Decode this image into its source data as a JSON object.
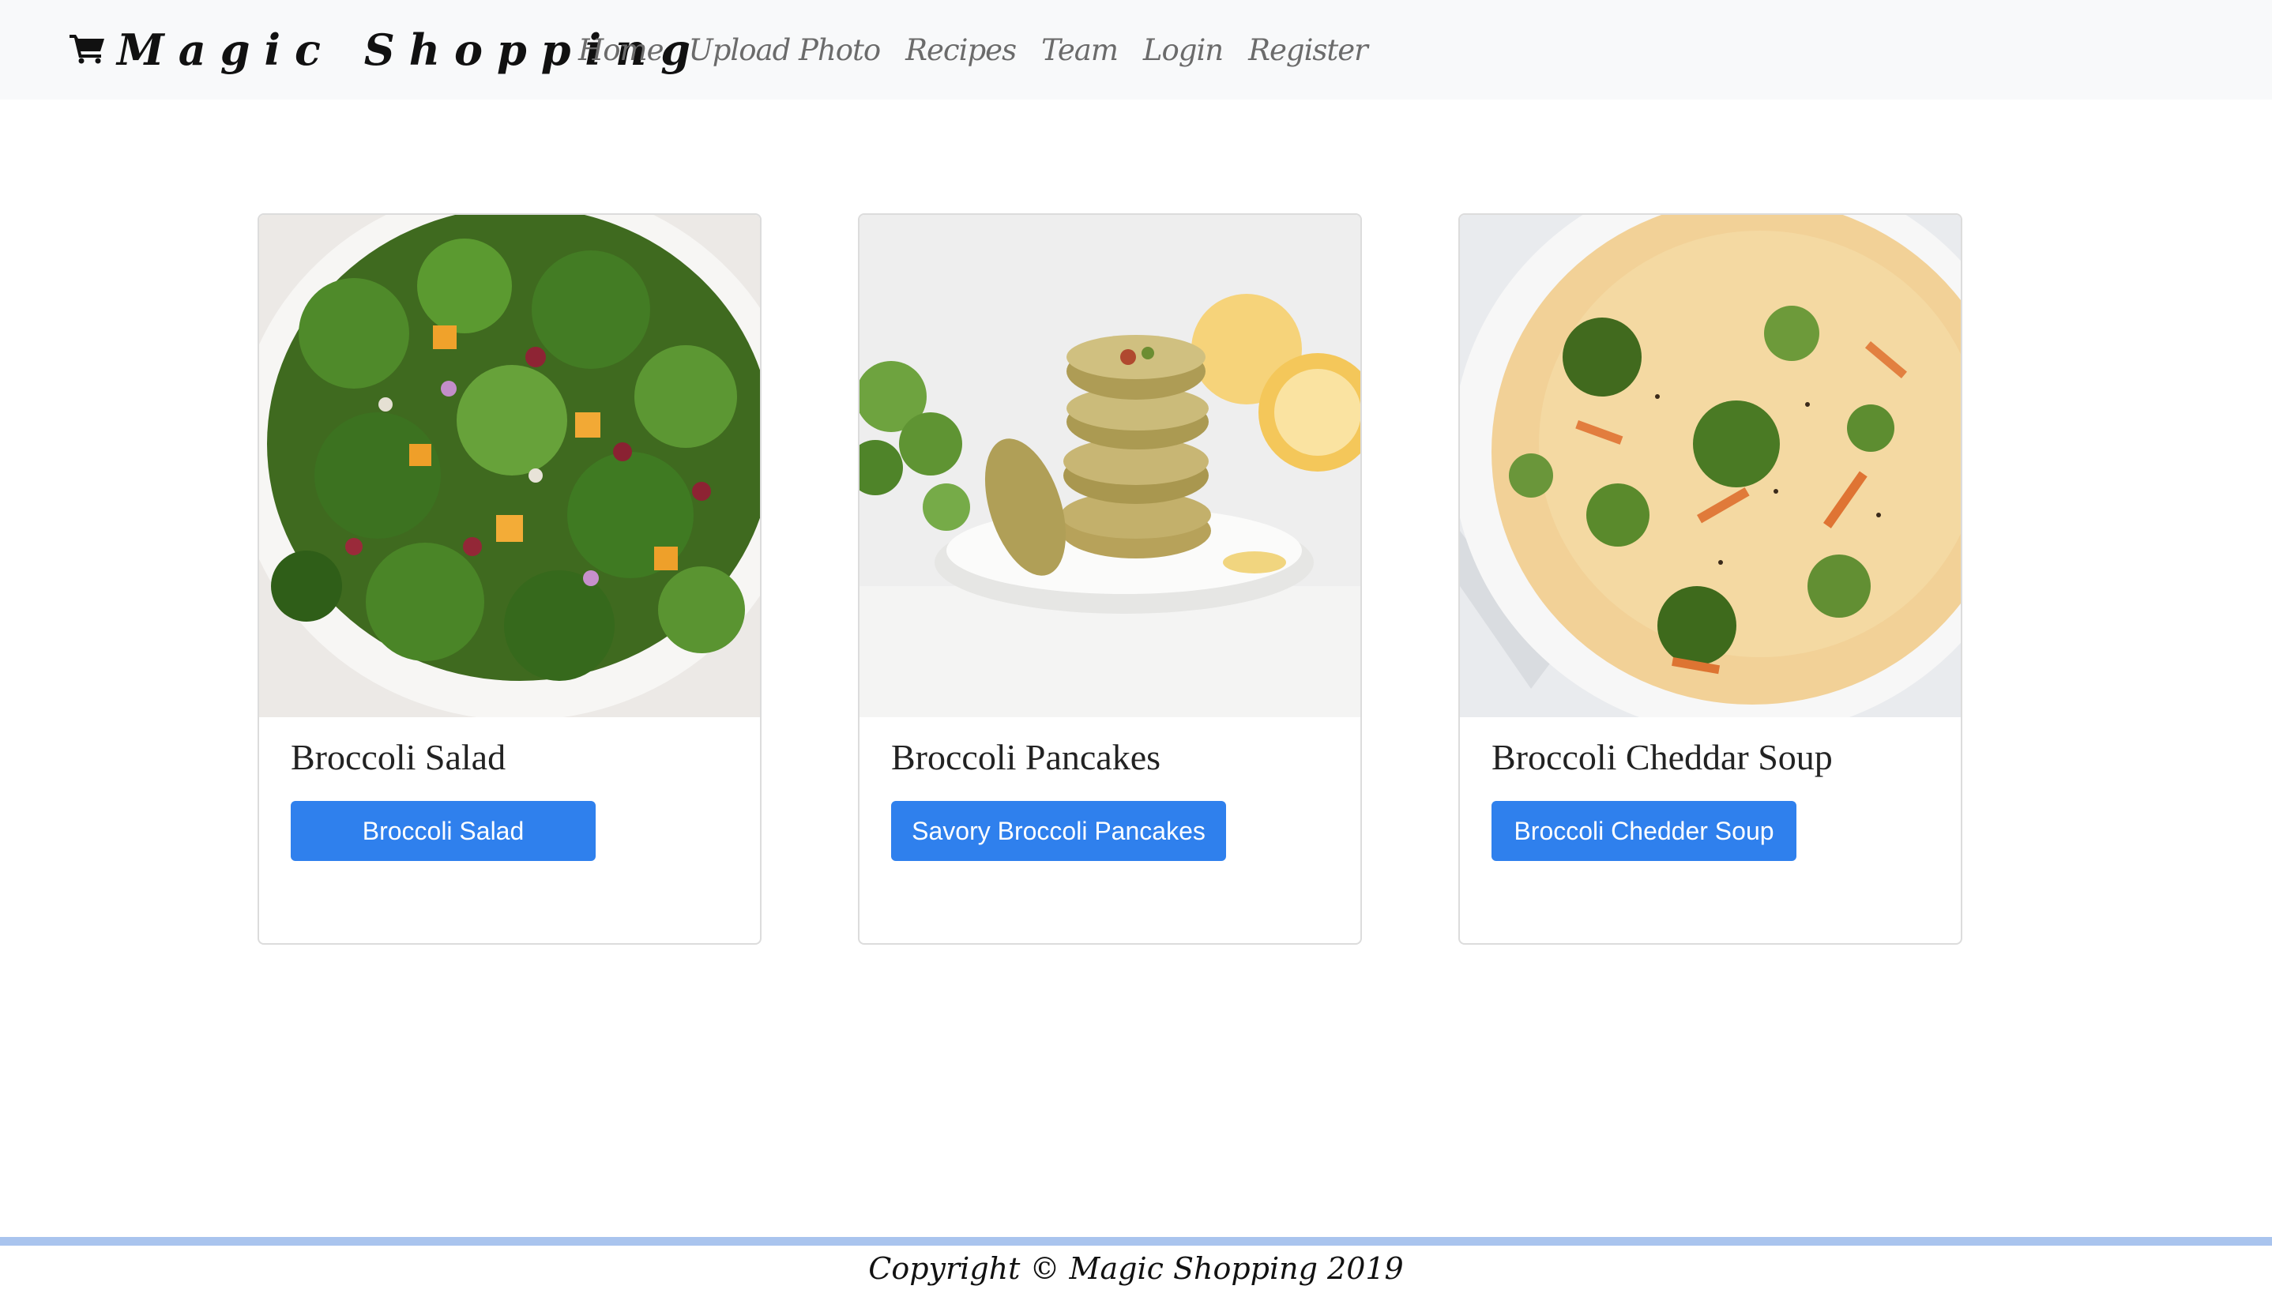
{
  "navbar": {
    "brand": "Magic Shopping",
    "brand_icon": "shopping-cart-icon",
    "links": [
      "Home",
      "Upload Photo",
      "Recipes",
      "Team",
      "Login",
      "Register"
    ]
  },
  "cards": [
    {
      "title": "Broccoli Salad",
      "button": "Broccoli Salad"
    },
    {
      "title": "Broccoli Pancakes",
      "button": "Savory Broccoli Pancakes"
    },
    {
      "title": "Broccoli Cheddar Soup",
      "button": "Broccoli Chedder Soup"
    }
  ],
  "footer": {
    "text": "Copyright © Magic Shopping 2019"
  },
  "colors": {
    "button": "#2f80ed",
    "navbar_bg": "#f8f9fa",
    "footer_line": "#a9c4ee"
  }
}
